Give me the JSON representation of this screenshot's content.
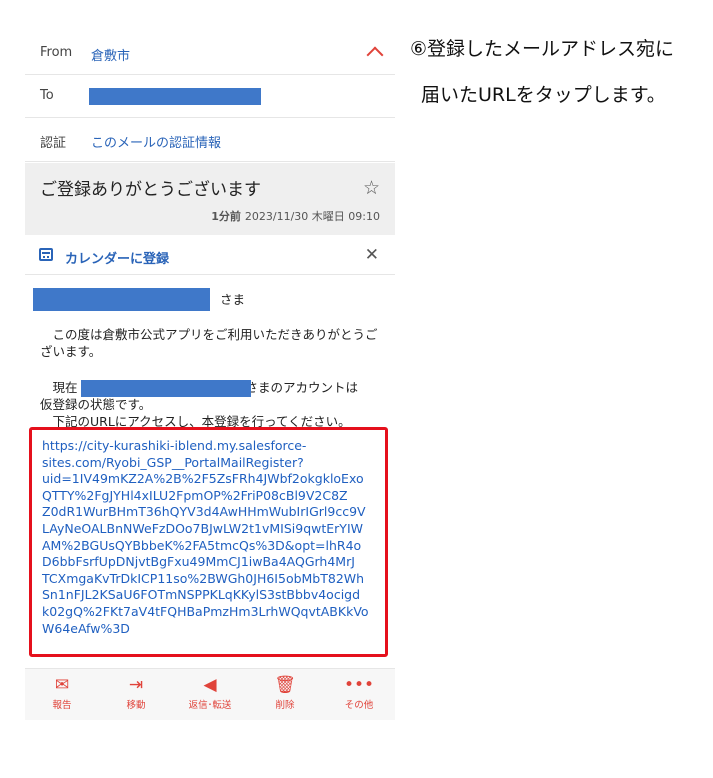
{
  "mail": {
    "from_label": "From",
    "from_value": "倉敷市",
    "to_label": "To",
    "auth_label": "認証",
    "auth_value": "このメールの認証情報",
    "subject": "ご登録ありがとうございます",
    "time_ago": "1分前",
    "date": "2023/11/30 木曜日 09:10",
    "calendar_label": "カレンダーに登録",
    "greeting_suffix": "さま",
    "para1": "　この度は倉敷市公式アプリをご利用いただきありがとうございます。",
    "para2_prefix": "　現在",
    "para2_suffix": "さまのアカウントは",
    "para2_line2": "仮登録の状態です。",
    "para3": "　下記のURLにアクセスし、本登録を行ってください。",
    "url": "https://city-kurashiki-iblend.my.salesforce-\nsites.com/Ryobi_GSP__PortalMailRegister?\nuid=1IV49mKZ2A%2B%2F5ZsFRh4JWbf2okgkloExo\nQTTY%2FgJYHl4xILU2FpmOP%2FriP08cBl9V2C8Z\nZ0dR1WurBHmT36hQYV3d4AwHHmWubIrIGrl9cc9V\nLAyNeOALBnNWeFzDOo7BJwLW2t1vMISi9qwtErYIW\nAM%2BGUsQYBbbeK%2FA5tmcQs%3D&opt=lhR4o\nD6bbFsrfUpDNjvtBgFxu49MmCJ1iwBa4AQGrh4MrJ\nTCXmgaKvTrDkICP11so%2BWGh0JH6I5obMbT82Wh\nSn1nFJL2KSaU6FOTmNSPPKLqKKylS3stBbbv4ocigd\nk02gQ%2FKt7aV4tFQHBaPmzHm3LrhWQqvtABKkVo\nW64eAfw%3D"
  },
  "toolbar": {
    "report": "報告",
    "move": "移動",
    "reply": "返信･転送",
    "delete": "削除",
    "more": "その他"
  },
  "caption": {
    "line1": "⑥登録したメールアドレス宛に",
    "line2": "届いたURLをタップします。"
  },
  "colors": {
    "accent": "#e0433a",
    "link": "#2a64b8",
    "highlight": "#e5101c",
    "redaction": "#3f78c9"
  },
  "icons": [
    "chevron-up-icon",
    "star-icon",
    "calendar-icon",
    "close-icon",
    "report-icon",
    "move-icon",
    "reply-icon",
    "trash-icon",
    "more-icon"
  ]
}
